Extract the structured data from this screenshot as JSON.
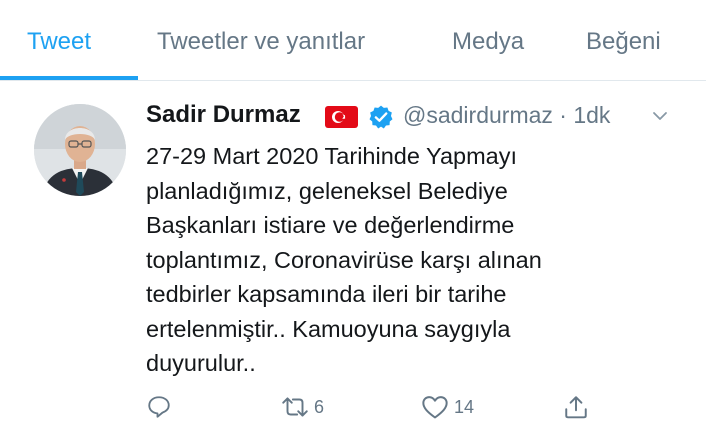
{
  "tabs": [
    {
      "label": "Tweet",
      "active": true
    },
    {
      "label": "Tweetler ve yanıtlar",
      "active": false
    },
    {
      "label": "Medya",
      "active": false
    },
    {
      "label": "Beğeni",
      "active": false
    }
  ],
  "tweet": {
    "display_name": "Sadir Durmaz",
    "handle_time": "@sadirdurmaz · 1dk",
    "lines": [
      "27-29 Mart 2020 Tarihinde Yapmayı",
      "planladığımız, geleneksel Belediye",
      "Başkanları istiare ve değerlendirme",
      "toplantımız, Coronavirüse karşı alınan",
      "tedbirler kapsamında ileri bir tarihe",
      "ertelenmiştir.. Kamuoyuna saygıyla",
      "duyurulur.."
    ],
    "retweet_count": "6",
    "like_count": "14"
  },
  "icons": {
    "flag": "turkey-flag-icon",
    "verified": "verified-badge-icon",
    "chevron": "chevron-down-icon",
    "reply": "reply-icon",
    "retweet": "retweet-icon",
    "like": "heart-icon",
    "share": "share-icon"
  },
  "colors": {
    "accent": "#1da1f2",
    "text": "#14171a",
    "muted": "#657786",
    "flag_red": "#e30a17"
  }
}
